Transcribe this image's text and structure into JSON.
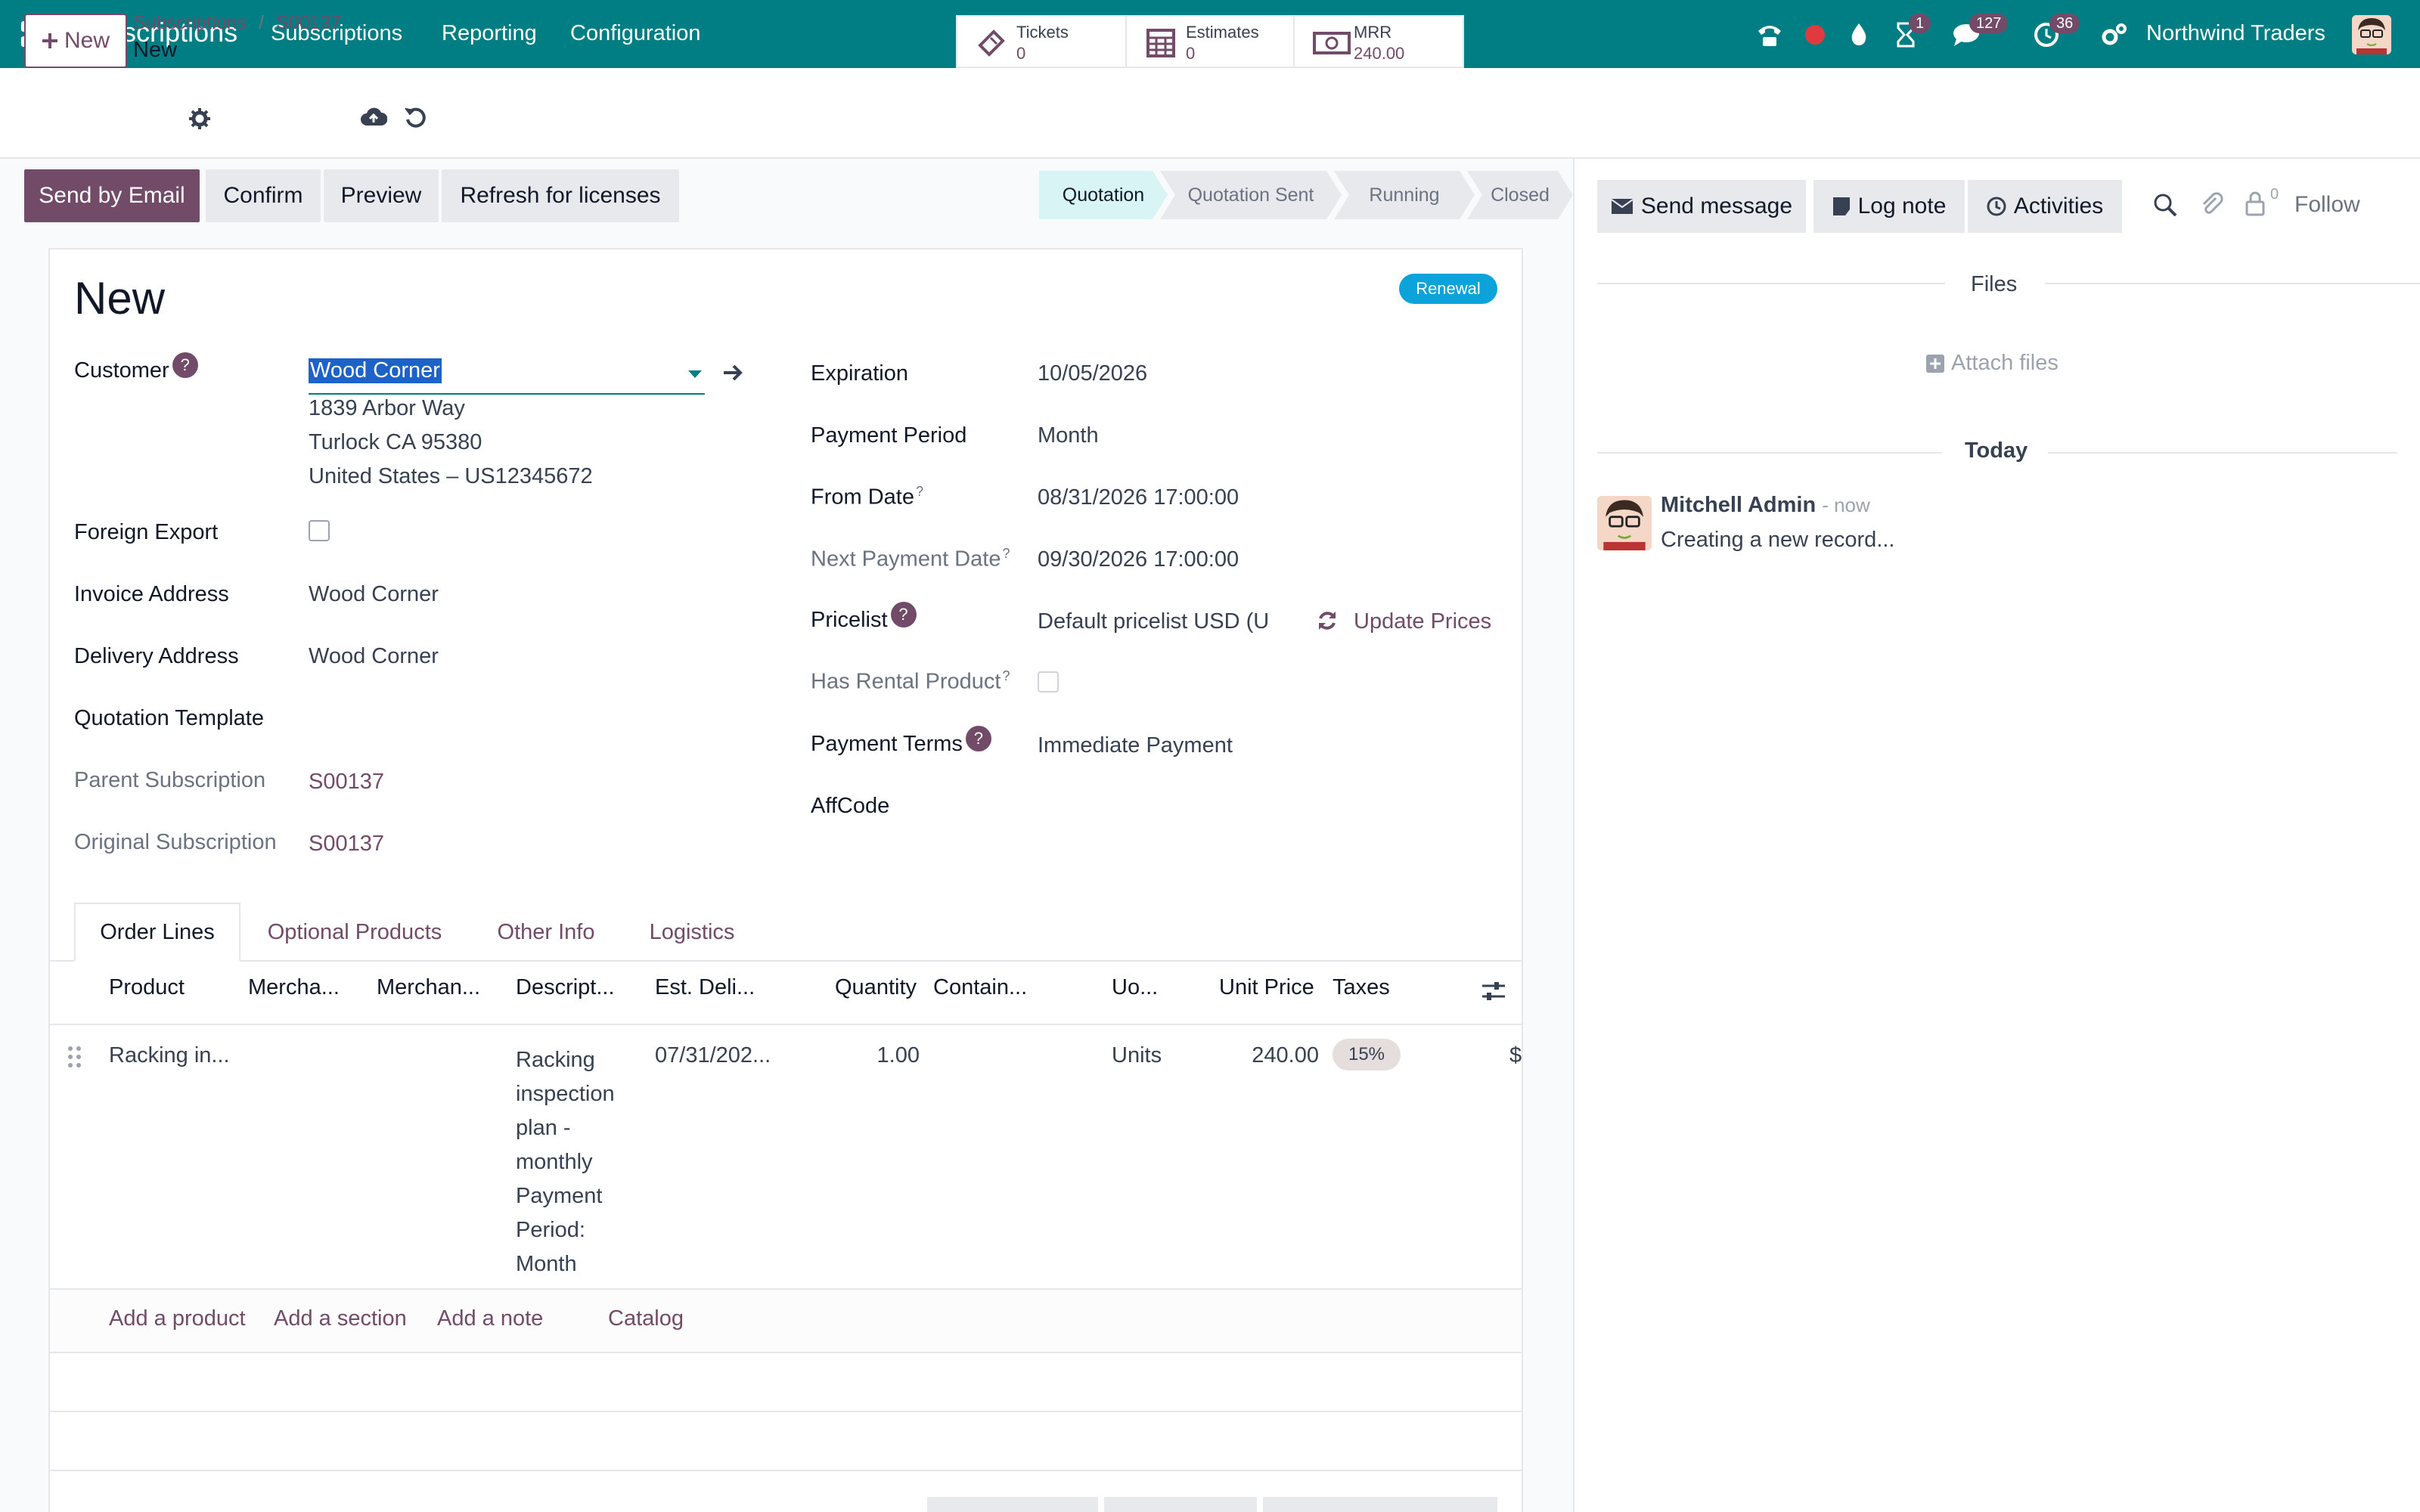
{
  "navbar": {
    "app_name": "Subscriptions",
    "menus": [
      "Subscriptions",
      "Reporting",
      "Configuration"
    ],
    "badges": {
      "activities": "1",
      "messages": "127",
      "timer": "36"
    },
    "company": "Northwind Traders",
    "icons": [
      "apps-grid-icon",
      "phone-icon",
      "record-icon",
      "drop-icon",
      "hourglass-icon",
      "chat-icon",
      "clock-icon",
      "settings-icon"
    ]
  },
  "control_panel": {
    "new_button": "New",
    "breadcrumb": [
      "Subscriptions",
      "S00137"
    ],
    "record_name": "New",
    "smart_buttons": [
      {
        "label": "Tickets",
        "value": "0",
        "icon": "ticket-icon"
      },
      {
        "label": "Estimates",
        "value": "0",
        "icon": "calculator-icon"
      },
      {
        "label": "MRR",
        "value": "240.00",
        "icon": "money-icon"
      }
    ]
  },
  "actions": {
    "send_email": "Send by Email",
    "confirm": "Confirm",
    "preview": "Preview",
    "refresh": "Refresh for licenses"
  },
  "statusbar": [
    "Quotation",
    "Quotation Sent",
    "Running",
    "Closed"
  ],
  "form": {
    "title": "New",
    "ribbon": "Renewal",
    "left": {
      "customer_label": "Customer",
      "customer_value": "Wood Corner",
      "address": [
        "1839 Arbor Way",
        "Turlock CA 95380",
        "United States – US12345672"
      ],
      "foreign_export_label": "Foreign Export",
      "invoice_address_label": "Invoice Address",
      "invoice_address_value": "Wood Corner",
      "delivery_address_label": "Delivery Address",
      "delivery_address_value": "Wood Corner",
      "quotation_template_label": "Quotation Template",
      "parent_subscription_label": "Parent Subscription",
      "parent_subscription_value": "S00137",
      "original_subscription_label": "Original Subscription",
      "original_subscription_value": "S00137"
    },
    "right": {
      "expiration_label": "Expiration",
      "expiration_value": "10/05/2026",
      "payment_period_label": "Payment Period",
      "payment_period_value": "Month",
      "from_date_label": "From Date",
      "from_date_value": "08/31/2026 17:00:00",
      "next_payment_label": "Next Payment Date",
      "next_payment_value": "09/30/2026 17:00:00",
      "pricelist_label": "Pricelist",
      "pricelist_value": "Default pricelist USD  (U",
      "update_prices": "Update Prices",
      "rental_label": "Has Rental Product",
      "payment_terms_label": "Payment Terms",
      "payment_terms_value": "Immediate Payment",
      "affcode_label": "AffCode"
    },
    "help_mark": "?"
  },
  "tabs": [
    "Order Lines",
    "Optional Products",
    "Other Info",
    "Logistics"
  ],
  "order_table": {
    "columns": [
      "Product",
      "Mercha...",
      "Merchan...",
      "Descript...",
      "Est. Deli...",
      "Quantity",
      "Contain...",
      "Uo...",
      "Unit Price",
      "Taxes"
    ],
    "rows": [
      {
        "product": "Racking in...",
        "description": [
          "Racking",
          "inspection",
          "plan -",
          "monthly",
          "Payment",
          "Period:",
          "Month"
        ],
        "est_delivery": "07/31/202...",
        "quantity": "1.00",
        "uom": "Units",
        "unit_price": "240.00",
        "taxes": "15%",
        "subtotal_cut": "$"
      }
    ],
    "footer_links": [
      "Add a product",
      "Add a section",
      "Add a note",
      "Catalog"
    ]
  },
  "chatter": {
    "send_message": "Send message",
    "log_note": "Log note",
    "activities": "Activities",
    "follow": "Follow",
    "follower_count": "0",
    "files_header": "Files",
    "attach_files": "Attach files",
    "today": "Today",
    "message": {
      "author": "Mitchell Admin",
      "time": "- now",
      "body": "Creating a new record..."
    }
  },
  "colors": {
    "brand_teal": "#017e84",
    "primary_purple": "#714b67",
    "selection_blue": "#1c62c9",
    "ribbon_blue": "#0ba3d9"
  }
}
